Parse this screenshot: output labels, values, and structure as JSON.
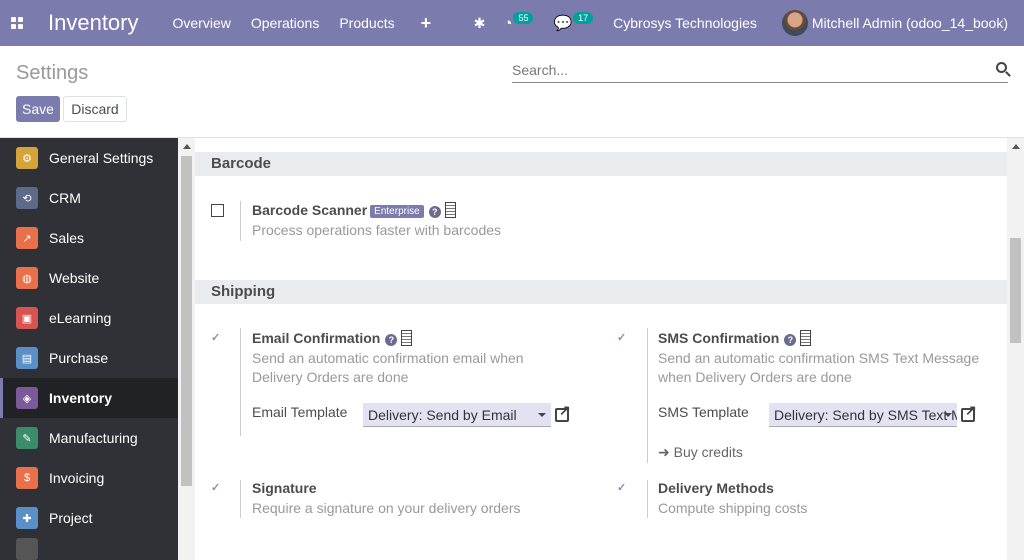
{
  "app": {
    "title": "Inventory"
  },
  "navbar": {
    "menus": [
      "Overview",
      "Operations",
      "Products"
    ],
    "plus_label": "+",
    "activity_count": "55",
    "messages_count": "17",
    "company": "Cybrosys Technologies",
    "user": "Mitchell Admin (odoo_14_book)"
  },
  "control_panel": {
    "title": "Settings",
    "search_placeholder": "Search...",
    "save_label": "Save",
    "discard_label": "Discard"
  },
  "sidebar": {
    "items": [
      {
        "label": "General Settings",
        "color": "#d4a43a",
        "icon": "gear-icon",
        "glyph": "⚙"
      },
      {
        "label": "CRM",
        "color": "#5e6a8a",
        "icon": "handshake-icon",
        "glyph": "⟲"
      },
      {
        "label": "Sales",
        "color": "#e8704a",
        "icon": "chart-icon",
        "glyph": "↗"
      },
      {
        "label": "Website",
        "color": "#e8704a",
        "icon": "globe-icon",
        "glyph": "◍"
      },
      {
        "label": "eLearning",
        "color": "#d9534f",
        "icon": "elearning-icon",
        "glyph": "▣"
      },
      {
        "label": "Purchase",
        "color": "#5b8fc7",
        "icon": "purchase-icon",
        "glyph": "▤"
      },
      {
        "label": "Inventory",
        "color": "#7c5a9a",
        "icon": "inventory-icon",
        "glyph": "◈",
        "active": true
      },
      {
        "label": "Manufacturing",
        "color": "#3a8c6a",
        "icon": "wrench-icon",
        "glyph": "✎"
      },
      {
        "label": "Invoicing",
        "color": "#e8704a",
        "icon": "invoice-icon",
        "glyph": "$"
      },
      {
        "label": "Project",
        "color": "#5b8fc7",
        "icon": "puzzle-icon",
        "glyph": "✚"
      }
    ]
  },
  "barcode": {
    "header": "Barcode",
    "scanner_title": "Barcode Scanner",
    "enterprise_badge": "Enterprise",
    "scanner_desc": "Process operations faster with barcodes",
    "scanner_checked": false
  },
  "shipping": {
    "header": "Shipping",
    "email": {
      "title": "Email Confirmation",
      "desc": "Send an automatic confirmation email when Delivery Orders are done",
      "template_label": "Email Template",
      "template_value": "Delivery: Send by Email",
      "checked": true
    },
    "sms": {
      "title": "SMS Confirmation",
      "desc": "Send an automatic confirmation SMS Text Message when Delivery Orders are done",
      "template_label": "SMS Template",
      "template_value": "Delivery: Send by SMS Text M",
      "buy_credits": "Buy credits",
      "checked": true
    },
    "signature": {
      "title": "Signature",
      "desc": "Require a signature on your delivery orders",
      "checked": true
    },
    "delivery_methods": {
      "title": "Delivery Methods",
      "desc": "Compute shipping costs",
      "checked": true
    }
  }
}
